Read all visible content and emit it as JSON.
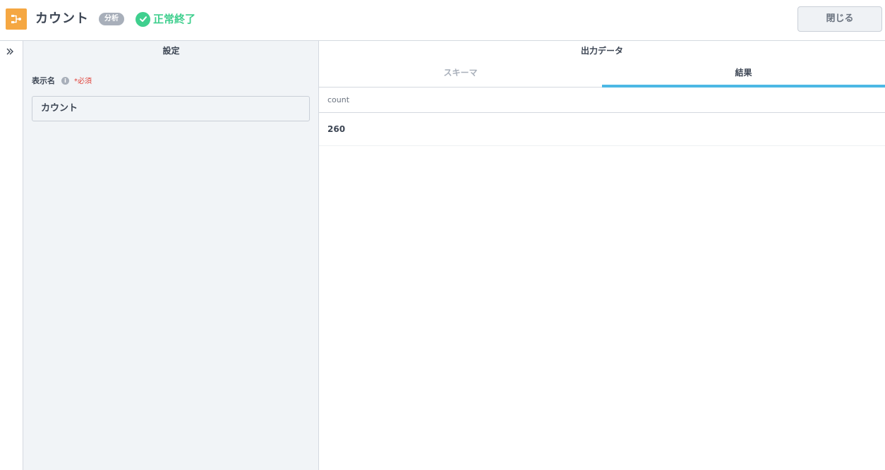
{
  "header": {
    "icon": "node-flow-icon",
    "title": "カウント",
    "badge": "分析",
    "status_icon": "check-circle-icon",
    "status_text": "正常終了",
    "close_label": "閉じる"
  },
  "rail": {
    "icon": "double-chevron-right-icon"
  },
  "settings": {
    "title": "設定",
    "field_label": "表示名",
    "info_icon": "info-icon",
    "info_glyph": "i",
    "required_text": "*必須",
    "name_value": "カウント"
  },
  "output": {
    "title": "出力データ",
    "tabs": [
      {
        "label": "スキーマ"
      },
      {
        "label": "結果"
      }
    ],
    "active_tab": "結果",
    "columns": [
      "count"
    ],
    "rows": [
      [
        "260"
      ]
    ]
  },
  "colors": {
    "accent_orange": "#f5a742",
    "status_green": "#3fcf8e",
    "tab_active": "#4cb8e4",
    "required_red": "#e0433b"
  }
}
